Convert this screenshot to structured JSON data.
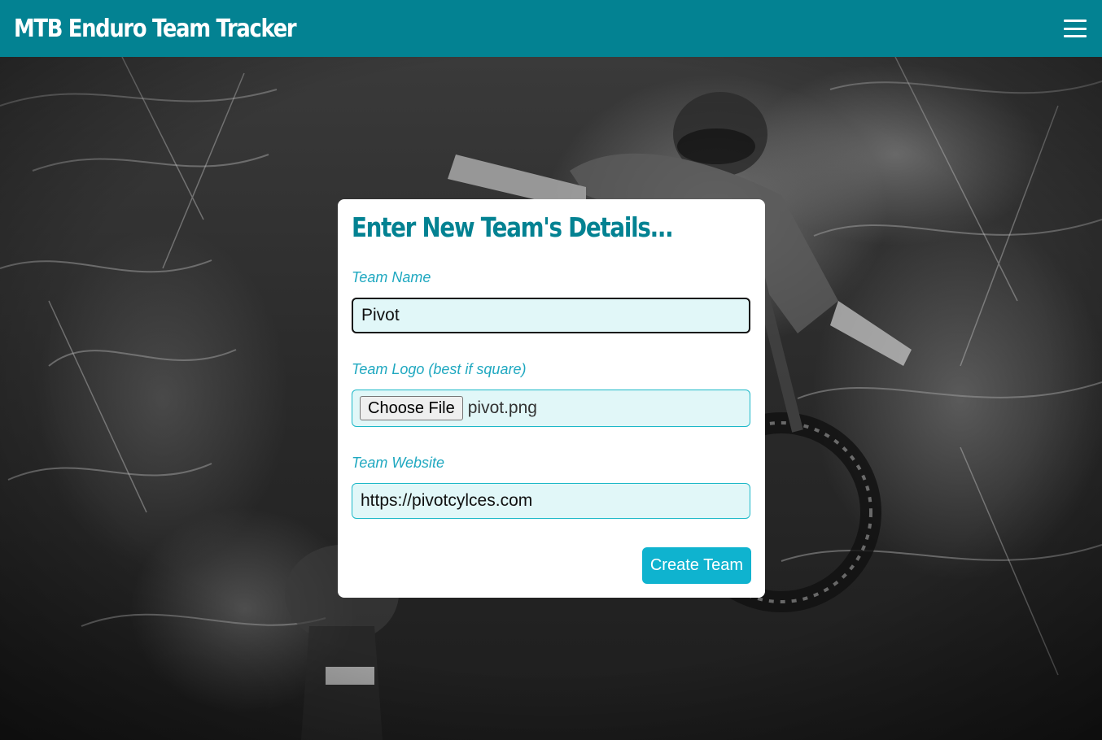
{
  "app": {
    "title": "MTB Enduro Team Tracker",
    "menu_icon": "hamburger-menu-icon",
    "brand_color": "#038292"
  },
  "form": {
    "heading": "Enter New Team's Details...",
    "team_name": {
      "label": "Team Name",
      "value": "Pivot"
    },
    "team_logo": {
      "label": "Team Logo (best if square)",
      "button_label": "Choose File",
      "file_name": "pivot.png"
    },
    "team_website": {
      "label": "Team Website",
      "value": "https://pivotcylces.com"
    },
    "submit_label": "Create Team",
    "accent_color": "#0fb3cf",
    "label_color": "#1fa8c0",
    "input_background": "#e1f7f8"
  }
}
